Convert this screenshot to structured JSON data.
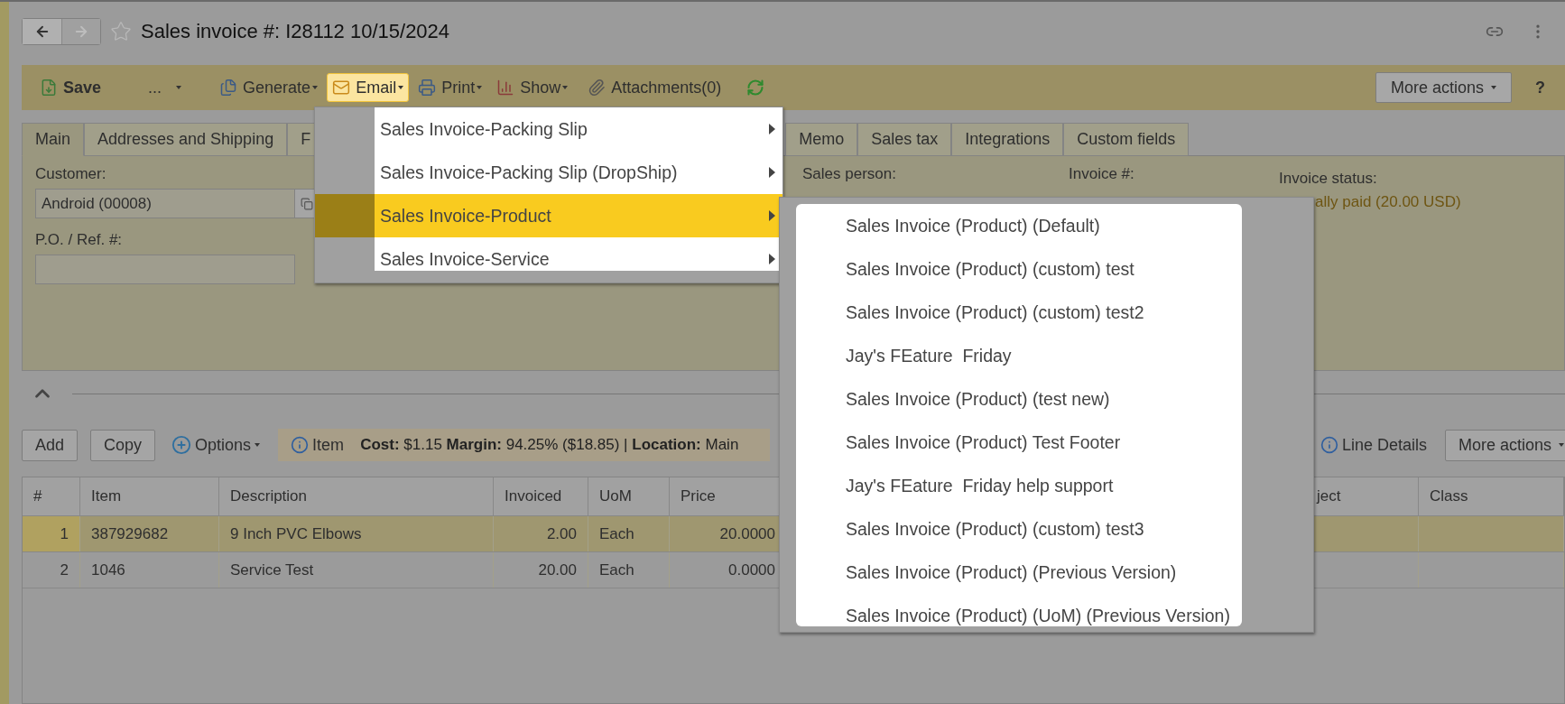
{
  "title": "Sales invoice #: I28112 10/15/2024",
  "toolbar": {
    "items": [
      {
        "kind": "save",
        "label": "Save",
        "open": false
      },
      {
        "kind": "more",
        "label": "...",
        "open": false
      },
      {
        "kind": "generate",
        "label": "Generate",
        "open": false
      },
      {
        "kind": "email",
        "label": "Email",
        "open": true
      },
      {
        "kind": "print",
        "label": "Print",
        "open": false
      },
      {
        "kind": "show",
        "label": "Show",
        "open": false
      },
      {
        "kind": "attachments",
        "label": "Attachments(0)",
        "open": false
      },
      {
        "kind": "refresh"
      }
    ],
    "more_actions": "More actions",
    "help": "?"
  },
  "tabs": [
    {
      "label": "Main",
      "selected": true
    },
    {
      "label": "Addresses and Shipping",
      "selected": false
    },
    {
      "label": "F",
      "selected": false
    },
    {
      "label": "Memo",
      "selected": false
    },
    {
      "label": "Sales tax",
      "selected": false
    },
    {
      "label": "Integrations",
      "selected": false
    },
    {
      "label": "Custom fields",
      "selected": false
    }
  ],
  "form": {
    "customer": {
      "label": "Customer:",
      "value": "Android (00008)"
    },
    "po": {
      "label": "P.O. / Ref. #:"
    },
    "sales_person": {
      "label": "Sales person:"
    },
    "invoice_number": {
      "label": "Invoice #:"
    },
    "status": {
      "label": "Invoice status:",
      "value": "ally paid (20.00 USD)"
    }
  },
  "grid_toolbar": {
    "buttons": [
      "Add",
      "Copy"
    ],
    "options": "Options",
    "info": {
      "label": "Item",
      "text": "**Cost:** $1.15 **Margin:** 94.25% ($18.85) | **Location:** Main"
    },
    "line_details": "Line Details",
    "more_actions": "More actions"
  },
  "table": {
    "columns": [
      {
        "label": "#",
        "numeric": true
      },
      {
        "label": "Item",
        "numeric": false
      },
      {
        "label": "Description",
        "numeric": false
      },
      {
        "label": "Invoiced",
        "numeric": true
      },
      {
        "label": "UoM",
        "numeric": false
      },
      {
        "label": "Price",
        "numeric": true
      },
      {
        "label": "ject"
      },
      {
        "label": "Class"
      }
    ],
    "rows": [
      {
        "selected": true,
        "cells": [
          "1",
          "387929682",
          "9 Inch PVC Elbows",
          "2.00",
          "Each",
          "20.0000"
        ]
      },
      {
        "selected": false,
        "cells": [
          "2",
          "1046",
          "Service Test",
          "20.00",
          "Each",
          "0.0000"
        ]
      }
    ]
  },
  "email_menu": {
    "items": [
      {
        "label": "Sales Invoice-Packing Slip",
        "selected": false
      },
      {
        "label": "Sales Invoice-Packing Slip (DropShip)",
        "selected": false
      },
      {
        "label": "Sales Invoice-Product",
        "selected": true
      },
      {
        "label": "Sales Invoice-Service",
        "selected": false
      }
    ]
  },
  "submenu": {
    "items": [
      "Sales Invoice (Product) (Default)",
      "Sales Invoice (Product) (custom) test",
      "Sales Invoice (Product) (custom) test2",
      "Jay's FEature  Friday",
      "Sales Invoice (Product) (test new)",
      "Sales Invoice (Product) Test Footer",
      "Jay's FEature  Friday help support",
      "Sales Invoice (Product) (custom) test3",
      "Sales Invoice (Product) (Previous Version)",
      "Sales Invoice (Product) (UoM) (Previous Version)"
    ]
  }
}
